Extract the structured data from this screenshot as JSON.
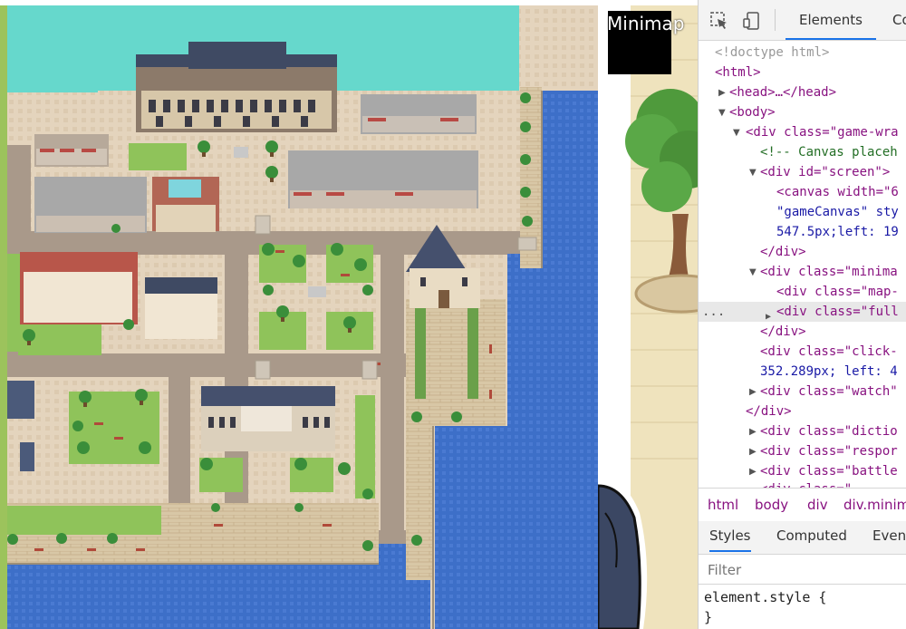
{
  "game": {
    "minimap_label": "Minimap"
  },
  "devtools": {
    "tabs": [
      "Elements",
      "Co"
    ],
    "dom_lines": [
      "<!doctype html>",
      "<html>",
      "<head>…</head>",
      "<body>",
      "<div class=\"game-wra",
      "<!-- Canvas placeh",
      "<div id=\"screen\">",
      "<canvas width=\"6",
      "\"gameCanvas\" sty",
      "547.5px;left: 19",
      "</div>",
      "<div class=\"minima",
      "<div class=\"map-",
      "<div class=\"full",
      "</div>",
      "<div class=\"click-",
      "352.289px; left: 4",
      "<div class=\"watch\"",
      "</div>",
      "<div class=\"dictio",
      "<div class=\"respor",
      "<div class=\"battle",
      "<div class=\"..."
    ],
    "gutter_marker": "...",
    "breadcrumbs": [
      "html",
      "body",
      "div",
      "div.minim"
    ],
    "styles_tabs": [
      "Styles",
      "Computed",
      "Even"
    ],
    "filter_placeholder": "Filter",
    "element_style_open": "element.style {",
    "element_style_close": "}"
  }
}
